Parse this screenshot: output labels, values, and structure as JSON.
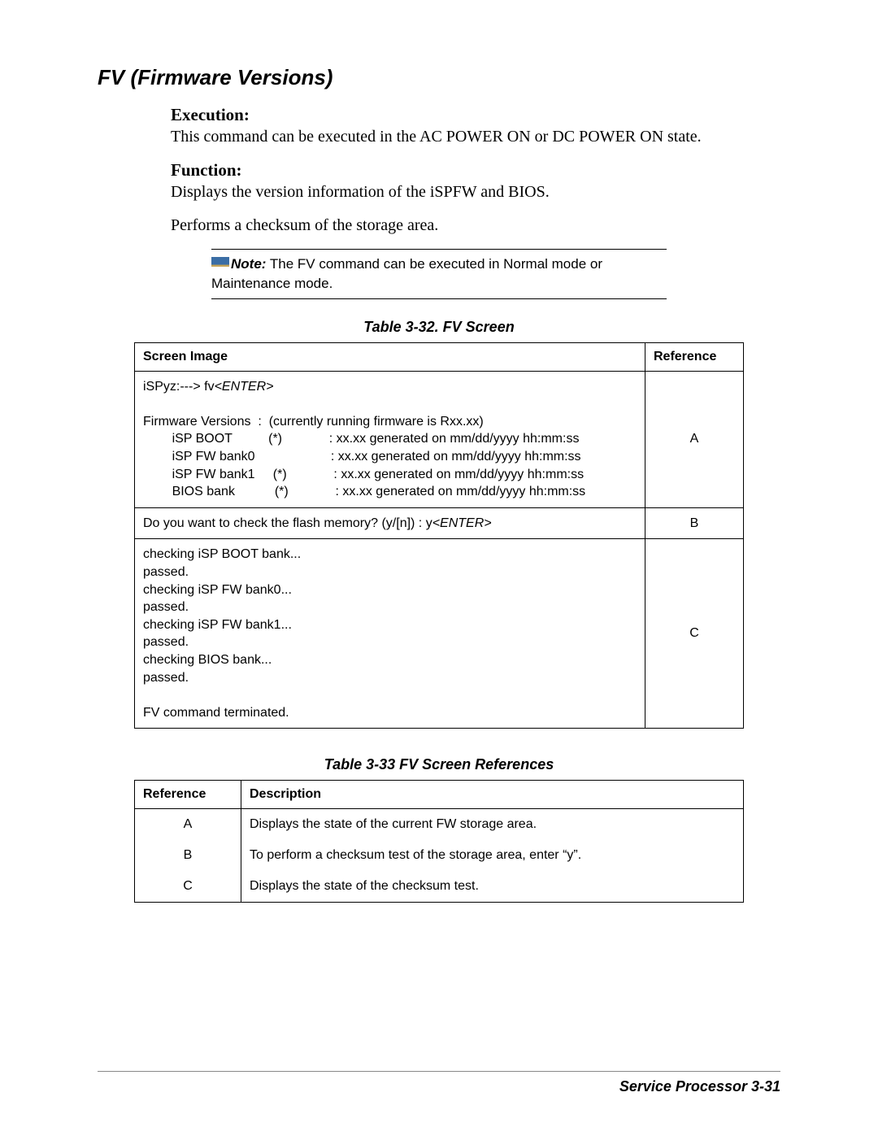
{
  "title": "FV (Firmware Versions)",
  "execution": {
    "heading": "Execution:",
    "text": "This command can be executed in the AC POWER ON or DC POWER ON state."
  },
  "function": {
    "heading": "Function:",
    "text1": "Displays the version information of the iSPFW and BIOS.",
    "text2": "Performs a checksum of the storage area."
  },
  "note": {
    "label": "Note:",
    "text": "  The FV command can be executed in Normal mode or Maintenance mode."
  },
  "table32": {
    "caption": "Table 3-32.  FV Screen",
    "header_left": "Screen Image",
    "header_right": "Reference",
    "rowA": {
      "prompt_pre": "iSPyz:---> fv",
      "prompt_enter": "<ENTER>",
      "line1": "Firmware Versions  :  (currently running firmware is Rxx.xx)",
      "line2": "        iSP BOOT          (*)             : xx.xx generated on mm/dd/yyyy hh:mm:ss",
      "line3": "        iSP FW bank0                     : xx.xx generated on mm/dd/yyyy hh:mm:ss",
      "line4": "        iSP FW bank1     (*)             : xx.xx generated on mm/dd/yyyy hh:mm:ss",
      "line5": "        BIOS bank           (*)             : xx.xx generated on mm/dd/yyyy hh:mm:ss",
      "ref": "A"
    },
    "rowB": {
      "line_pre": "Do you want to check the flash memory? (y/[n]) : y",
      "line_enter": "<ENTER>",
      "ref": "B"
    },
    "rowC": {
      "line1": "checking iSP BOOT bank...",
      "line2": "passed.",
      "line3": "checking iSP FW bank0...",
      "line4": "passed.",
      "line5": "checking iSP FW bank1...",
      "line6": "passed.",
      "line7": "checking BIOS bank...",
      "line8": "passed.",
      "line9": "",
      "line10": "FV command terminated.",
      "ref": "C"
    }
  },
  "table33": {
    "caption": "Table 3-33  FV Screen References",
    "header_left": "Reference",
    "header_right": "Description",
    "rows": [
      {
        "ref": "A",
        "desc": "Displays the state of the current FW storage area."
      },
      {
        "ref": "B",
        "desc": "To perform a checksum test of the storage area, enter “y”."
      },
      {
        "ref": "C",
        "desc": "Displays the state of the checksum test."
      }
    ]
  },
  "footer": "Service Processor    3-31"
}
